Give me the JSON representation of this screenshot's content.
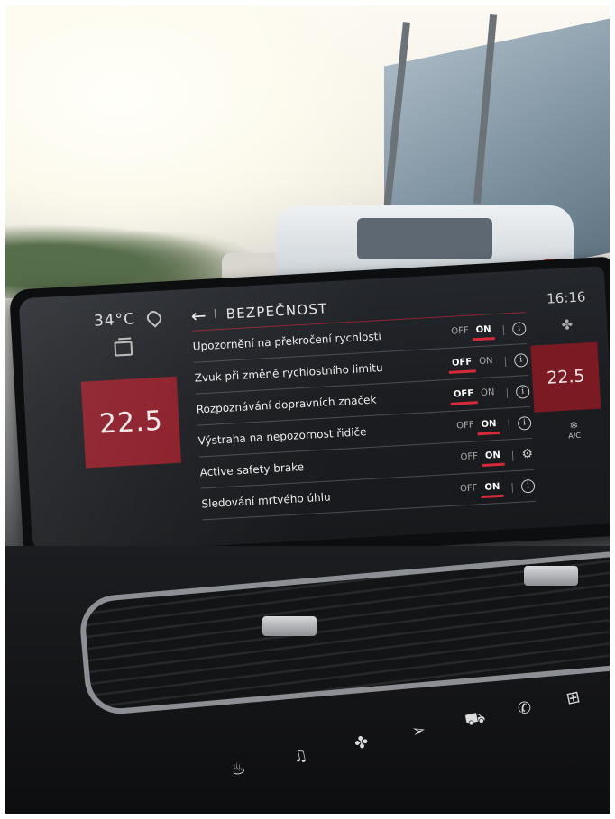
{
  "screen": {
    "outside_temp": "34°C",
    "left_temp": "22.5",
    "right_temp": "22.5",
    "clock": "16:16",
    "ac_label": "A/C",
    "header": {
      "back_icon": "back-arrow-icon",
      "separator": "I",
      "title": "BEZPEČNOST"
    },
    "settings": [
      {
        "label": "Upozornění na překročení rychlosti",
        "off": "OFF",
        "on": "ON",
        "state": "on",
        "trailing": "info-icon"
      },
      {
        "label": "Zvuk při změně rychlostního limitu",
        "off": "OFF",
        "on": "ON",
        "state": "off",
        "trailing": "info-icon"
      },
      {
        "label": "Rozpoznávání dopravních značek",
        "off": "OFF",
        "on": "ON",
        "state": "off",
        "trailing": "info-icon"
      },
      {
        "label": "Výstraha na nepozornost řidiče",
        "off": "OFF",
        "on": "ON",
        "state": "on",
        "trailing": "info-icon"
      },
      {
        "label": "Active safety brake",
        "off": "OFF",
        "on": "ON",
        "state": "on",
        "trailing": "gear-icon"
      },
      {
        "label": "Sledování mrtvého úhlu",
        "off": "OFF",
        "on": "ON",
        "state": "on",
        "trailing": "info-icon"
      }
    ],
    "accent_color": "#d42a3a",
    "temp_box_color": "#8a1b26"
  }
}
